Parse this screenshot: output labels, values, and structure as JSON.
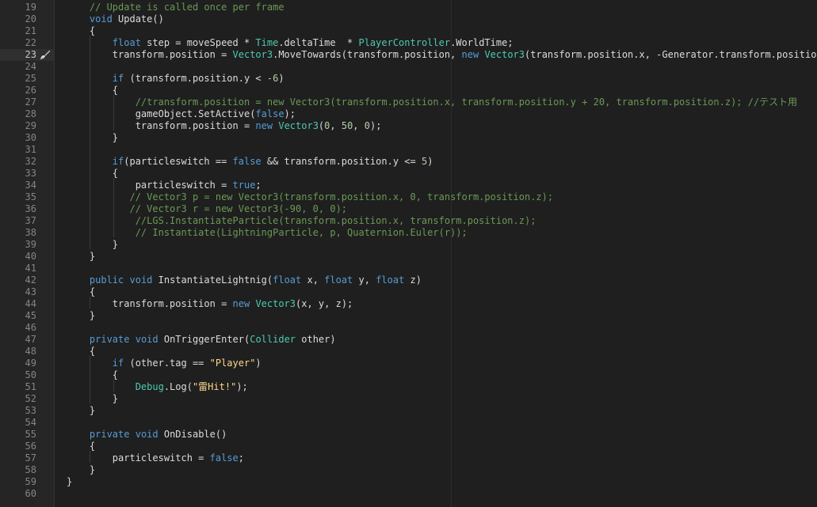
{
  "editor": {
    "colors": {
      "background": "#1e1e1e",
      "keyword": "#569cd6",
      "type": "#4ec9b0",
      "comment": "#6a9955",
      "number": "#b5cea8",
      "string": "#ffd68a",
      "text": "#dcdcdc"
    },
    "current_line": "23",
    "gutter_icon": "paintbrush-icon",
    "lines": [
      {
        "n": "19",
        "tokens": [
          {
            "t": "    "
          },
          {
            "t": "// Update is called once per frame",
            "c": "cmt"
          }
        ]
      },
      {
        "n": "20",
        "tokens": [
          {
            "t": "    "
          },
          {
            "t": "void",
            "c": "kw"
          },
          {
            "t": " Update()"
          }
        ]
      },
      {
        "n": "21",
        "tokens": [
          {
            "t": "    {"
          }
        ]
      },
      {
        "n": "22",
        "tokens": [
          {
            "t": "        "
          },
          {
            "t": "float",
            "c": "kw"
          },
          {
            "t": " step = moveSpeed * "
          },
          {
            "t": "Time",
            "c": "type"
          },
          {
            "t": ".deltaTime  * "
          },
          {
            "t": "PlayerController",
            "c": "type"
          },
          {
            "t": ".WorldTime;"
          }
        ]
      },
      {
        "n": "23",
        "tokens": [
          {
            "t": "        transform.position = "
          },
          {
            "t": "Vector3",
            "c": "type"
          },
          {
            "t": ".MoveTowards(transform.position, "
          },
          {
            "t": "new",
            "c": "kw"
          },
          {
            "t": " "
          },
          {
            "t": "Vector3",
            "c": "type"
          },
          {
            "t": "(transform.position.x, -Generator.transform.positio"
          }
        ]
      },
      {
        "n": "24",
        "tokens": []
      },
      {
        "n": "25",
        "tokens": [
          {
            "t": "        "
          },
          {
            "t": "if",
            "c": "kw"
          },
          {
            "t": " (transform.position.y < "
          },
          {
            "t": "-6",
            "c": "num"
          },
          {
            "t": ")"
          }
        ]
      },
      {
        "n": "26",
        "tokens": [
          {
            "t": "        {"
          }
        ]
      },
      {
        "n": "27",
        "tokens": [
          {
            "t": "            "
          },
          {
            "t": "//transform.position = new Vector3(transform.position.x, transform.position.y + 20, transform.position.z); //テスト用",
            "c": "cmt"
          }
        ]
      },
      {
        "n": "28",
        "tokens": [
          {
            "t": "            gameObject.SetActive("
          },
          {
            "t": "false",
            "c": "kw"
          },
          {
            "t": ");"
          }
        ]
      },
      {
        "n": "29",
        "tokens": [
          {
            "t": "            transform.position = "
          },
          {
            "t": "new",
            "c": "kw"
          },
          {
            "t": " "
          },
          {
            "t": "Vector3",
            "c": "type"
          },
          {
            "t": "("
          },
          {
            "t": "0",
            "c": "num"
          },
          {
            "t": ", "
          },
          {
            "t": "50",
            "c": "num"
          },
          {
            "t": ", "
          },
          {
            "t": "0",
            "c": "num"
          },
          {
            "t": ");"
          }
        ]
      },
      {
        "n": "30",
        "tokens": [
          {
            "t": "        }"
          }
        ]
      },
      {
        "n": "31",
        "tokens": []
      },
      {
        "n": "32",
        "tokens": [
          {
            "t": "        "
          },
          {
            "t": "if",
            "c": "kw"
          },
          {
            "t": "(particleswitch == "
          },
          {
            "t": "false",
            "c": "kw"
          },
          {
            "t": " && transform.position.y <= "
          },
          {
            "t": "5",
            "c": "num"
          },
          {
            "t": ")"
          }
        ]
      },
      {
        "n": "33",
        "tokens": [
          {
            "t": "        {"
          }
        ]
      },
      {
        "n": "34",
        "tokens": [
          {
            "t": "            particleswitch = "
          },
          {
            "t": "true",
            "c": "kw"
          },
          {
            "t": ";"
          }
        ]
      },
      {
        "n": "35",
        "tokens": [
          {
            "t": "           "
          },
          {
            "t": "// Vector3 p = new Vector3(transform.position.x, 0, transform.position.z);",
            "c": "cmt"
          }
        ]
      },
      {
        "n": "36",
        "tokens": [
          {
            "t": "           "
          },
          {
            "t": "// Vector3 r = new Vector3(-90, 0, 0);",
            "c": "cmt"
          }
        ]
      },
      {
        "n": "37",
        "tokens": [
          {
            "t": "            "
          },
          {
            "t": "//LGS.InstantiateParticle(transform.position.x, transform.position.z);",
            "c": "cmt"
          }
        ]
      },
      {
        "n": "38",
        "tokens": [
          {
            "t": "            "
          },
          {
            "t": "// Instantiate(LightningParticle, p, Quaternion.Euler(r));",
            "c": "cmt"
          }
        ]
      },
      {
        "n": "39",
        "tokens": [
          {
            "t": "        }"
          }
        ]
      },
      {
        "n": "40",
        "tokens": [
          {
            "t": "    }"
          }
        ]
      },
      {
        "n": "41",
        "tokens": []
      },
      {
        "n": "42",
        "tokens": [
          {
            "t": "    "
          },
          {
            "t": "public",
            "c": "kw"
          },
          {
            "t": " "
          },
          {
            "t": "void",
            "c": "kw"
          },
          {
            "t": " InstantiateLightnig("
          },
          {
            "t": "float",
            "c": "kw"
          },
          {
            "t": " x, "
          },
          {
            "t": "float",
            "c": "kw"
          },
          {
            "t": " y, "
          },
          {
            "t": "float",
            "c": "kw"
          },
          {
            "t": " z)"
          }
        ]
      },
      {
        "n": "43",
        "tokens": [
          {
            "t": "    {"
          }
        ]
      },
      {
        "n": "44",
        "tokens": [
          {
            "t": "        transform.position = "
          },
          {
            "t": "new",
            "c": "kw"
          },
          {
            "t": " "
          },
          {
            "t": "Vector3",
            "c": "type"
          },
          {
            "t": "(x, y, z);"
          }
        ]
      },
      {
        "n": "45",
        "tokens": [
          {
            "t": "    }"
          }
        ]
      },
      {
        "n": "46",
        "tokens": []
      },
      {
        "n": "47",
        "tokens": [
          {
            "t": "    "
          },
          {
            "t": "private",
            "c": "kw"
          },
          {
            "t": " "
          },
          {
            "t": "void",
            "c": "kw"
          },
          {
            "t": " OnTriggerEnter("
          },
          {
            "t": "Collider",
            "c": "type"
          },
          {
            "t": " other)"
          }
        ]
      },
      {
        "n": "48",
        "tokens": [
          {
            "t": "    {"
          }
        ]
      },
      {
        "n": "49",
        "tokens": [
          {
            "t": "        "
          },
          {
            "t": "if",
            "c": "kw"
          },
          {
            "t": " (other.tag == "
          },
          {
            "t": "\"Player\"",
            "c": "str"
          },
          {
            "t": ")"
          }
        ]
      },
      {
        "n": "50",
        "tokens": [
          {
            "t": "        {"
          }
        ]
      },
      {
        "n": "51",
        "tokens": [
          {
            "t": "            "
          },
          {
            "t": "Debug",
            "c": "type"
          },
          {
            "t": ".Log("
          },
          {
            "t": "\"雷Hit!\"",
            "c": "str"
          },
          {
            "t": ");"
          }
        ]
      },
      {
        "n": "52",
        "tokens": [
          {
            "t": "        }"
          }
        ]
      },
      {
        "n": "53",
        "tokens": [
          {
            "t": "    }"
          }
        ]
      },
      {
        "n": "54",
        "tokens": []
      },
      {
        "n": "55",
        "tokens": [
          {
            "t": "    "
          },
          {
            "t": "private",
            "c": "kw"
          },
          {
            "t": " "
          },
          {
            "t": "void",
            "c": "kw"
          },
          {
            "t": " OnDisable()"
          }
        ]
      },
      {
        "n": "56",
        "tokens": [
          {
            "t": "    {"
          }
        ]
      },
      {
        "n": "57",
        "tokens": [
          {
            "t": "        particleswitch = "
          },
          {
            "t": "false",
            "c": "kw"
          },
          {
            "t": ";"
          }
        ]
      },
      {
        "n": "58",
        "tokens": [
          {
            "t": "    }"
          }
        ]
      },
      {
        "n": "59",
        "tokens": [
          {
            "t": "}"
          }
        ]
      },
      {
        "n": "60",
        "tokens": []
      }
    ]
  }
}
